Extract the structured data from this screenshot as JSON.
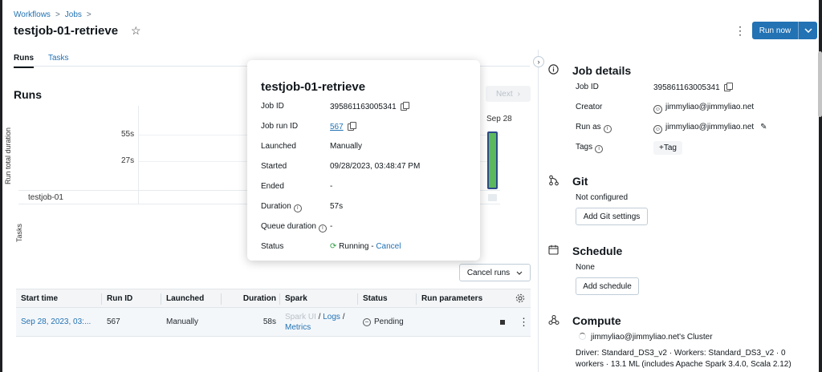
{
  "breadcrumb": {
    "items": [
      "Workflows",
      "Jobs"
    ],
    "separator": ">"
  },
  "header": {
    "title": "testjob-01-retrieve",
    "run_now_label": "Run now"
  },
  "tabs": [
    {
      "label": "Runs",
      "active": true
    },
    {
      "label": "Tasks",
      "active": false
    }
  ],
  "runs_section": {
    "title": "Runs",
    "next_label": "Next",
    "cancel_runs_label": "Cancel runs"
  },
  "chart_data": {
    "type": "bar",
    "ylabel": "Run total duration",
    "task_axis_label": "Tasks",
    "y_ticks": [
      "55s",
      "27s"
    ],
    "categories": [
      "Sep 28"
    ],
    "values": [
      57
    ],
    "task_rows": [
      "testjob-01"
    ],
    "bar_color": "#5cb85c"
  },
  "table": {
    "headers": [
      "Start time",
      "Run ID",
      "Launched",
      "Duration",
      "Spark",
      "Status",
      "Run parameters"
    ],
    "rows": [
      {
        "start_time": "Sep 28, 2023, 03:...",
        "run_id": "567",
        "launched": "Manually",
        "duration": "58s",
        "spark_ui": "Spark UI",
        "spark_sep1": " / ",
        "logs": "Logs",
        "spark_sep2": " /",
        "metrics": "Metrics",
        "status": "Pending"
      }
    ]
  },
  "popup": {
    "title": "testjob-01-retrieve",
    "rows": [
      {
        "label": "Job ID",
        "value": "395861163005341"
      },
      {
        "label": "Job run ID",
        "value": "567"
      },
      {
        "label": "Launched",
        "value": "Manually"
      },
      {
        "label": "Started",
        "value": "09/28/2023, 03:48:47 PM"
      },
      {
        "label": "Ended",
        "value": "-"
      },
      {
        "label": "Duration",
        "value": "57s"
      },
      {
        "label": "Queue duration",
        "value": "-"
      },
      {
        "label": "Status",
        "value": "Running",
        "sep": " - ",
        "action": "Cancel"
      }
    ]
  },
  "job_details": {
    "title": "Job details",
    "job_id_label": "Job ID",
    "job_id": "395861163005341",
    "creator_label": "Creator",
    "creator": "jimmyliao@jimmyliao.net",
    "run_as_label": "Run as",
    "run_as": "jimmyliao@jimmyliao.net",
    "tags_label": "Tags",
    "add_tag_label": "+Tag"
  },
  "git": {
    "title": "Git",
    "status": "Not configured",
    "button": "Add Git settings"
  },
  "schedule": {
    "title": "Schedule",
    "status": "None",
    "button": "Add schedule"
  },
  "compute": {
    "title": "Compute",
    "cluster_name": "jimmyliao@jimmyliao.net's Cluster",
    "details_line1": "Driver: Standard_DS3_v2 · Workers: Standard_DS3_v2 · 0",
    "details_line2": "workers · 13.1 ML (includes Apache Spark 3.4.0, Scala 2.12)"
  },
  "colors": {
    "accent": "#2272b4",
    "running": "#2e9e44"
  }
}
